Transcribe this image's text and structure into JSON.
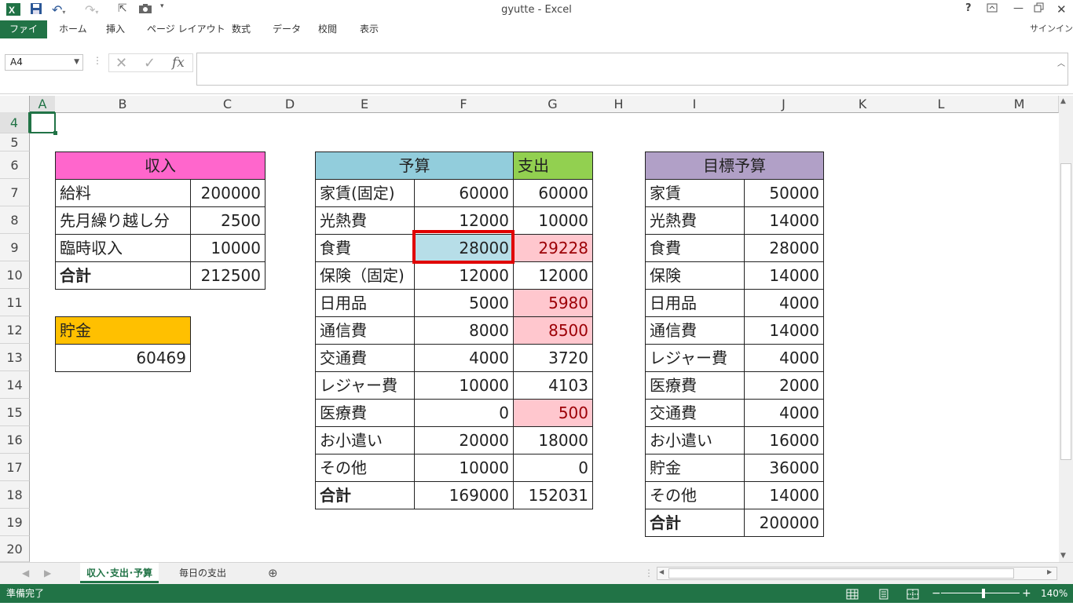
{
  "window": {
    "title": "gyutte - Excel"
  },
  "ribbon": {
    "tabs": [
      "ファイル",
      "ホーム",
      "挿入",
      "ページ レイアウト",
      "数式",
      "データ",
      "校閲",
      "表示"
    ],
    "signin": "サインイン"
  },
  "formula_bar": {
    "name_box": "A4",
    "fx": "fx",
    "value": ""
  },
  "grid": {
    "columns": [
      "A",
      "B",
      "C",
      "D",
      "E",
      "F",
      "G",
      "H",
      "I",
      "J",
      "K",
      "L",
      "M"
    ],
    "rows": [
      "4",
      "5",
      "6",
      "7",
      "8",
      "9",
      "10",
      "11",
      "12",
      "13",
      "14",
      "15",
      "16",
      "17",
      "18",
      "19",
      "20"
    ],
    "selected_cell": "A4"
  },
  "income": {
    "header": "収入",
    "rows": [
      {
        "label": "給料",
        "value": "200000"
      },
      {
        "label": "先月繰り越し分",
        "value": "2500"
      },
      {
        "label": "臨時収入",
        "value": "10000"
      }
    ],
    "total_label": "合計",
    "total_value": "212500"
  },
  "savings": {
    "header": "貯金",
    "value": "60469"
  },
  "budget": {
    "budget_header": "予算",
    "expense_header": "支出",
    "rows": [
      {
        "label": "家賃(固定)",
        "budget": "60000",
        "expense": "60000"
      },
      {
        "label": "光熱費",
        "budget": "12000",
        "expense": "10000"
      },
      {
        "label": "食費",
        "budget": "28000",
        "expense": "29228"
      },
      {
        "label": "保険（固定)",
        "budget": "12000",
        "expense": "12000"
      },
      {
        "label": "日用品",
        "budget": "5000",
        "expense": "5980"
      },
      {
        "label": "通信費",
        "budget": "8000",
        "expense": "8500"
      },
      {
        "label": "交通費",
        "budget": "4000",
        "expense": "3720"
      },
      {
        "label": "レジャー費",
        "budget": "10000",
        "expense": "4103"
      },
      {
        "label": "医療費",
        "budget": "0",
        "expense": "500"
      },
      {
        "label": "お小遣い",
        "budget": "20000",
        "expense": "18000"
      },
      {
        "label": "その他",
        "budget": "10000",
        "expense": "0"
      }
    ],
    "total_label": "合計",
    "total_budget": "169000",
    "total_expense": "152031"
  },
  "target": {
    "header": "目標予算",
    "rows": [
      {
        "label": "家賃",
        "value": "50000"
      },
      {
        "label": "光熱費",
        "value": "14000"
      },
      {
        "label": "食費",
        "value": "28000"
      },
      {
        "label": "保険",
        "value": "14000"
      },
      {
        "label": "日用品",
        "value": "4000"
      },
      {
        "label": "通信費",
        "value": "14000"
      },
      {
        "label": "レジャー費",
        "value": "4000"
      },
      {
        "label": "医療費",
        "value": "2000"
      },
      {
        "label": "交通費",
        "value": "4000"
      },
      {
        "label": "お小遣い",
        "value": "16000"
      },
      {
        "label": "貯金",
        "value": "36000"
      },
      {
        "label": "その他",
        "value": "14000"
      }
    ],
    "total_label": "合計",
    "total_value": "200000"
  },
  "sheets": {
    "tabs": [
      "収入･支出･予算",
      "毎日の支出"
    ],
    "active": 0
  },
  "status": {
    "ready": "準備完了",
    "zoom": "140%"
  },
  "colors": {
    "excel_green": "#217346",
    "income_header": "#ff66cc",
    "savings_header": "#ffc000",
    "budget_header": "#92cddc",
    "expense_header": "#92d050",
    "target_header": "#b1a0c7",
    "over_budget_fill": "#ffc7ce",
    "over_budget_text": "#9c0006",
    "highlight_fill": "#b7dee8",
    "highlight_border": "#e00000"
  }
}
